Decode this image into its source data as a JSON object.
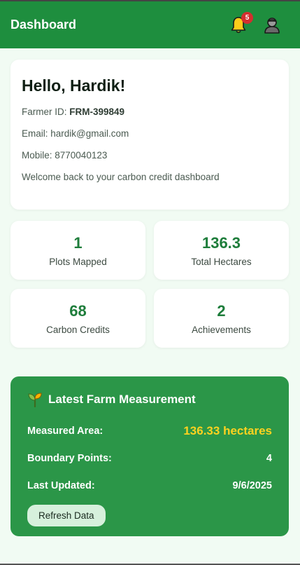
{
  "header": {
    "title": "Dashboard",
    "notification_count": "5",
    "bell_icon": "bell-icon",
    "profile_icon": "user-icon"
  },
  "profile": {
    "greeting": "Hello, Hardik!",
    "farmer_id_label": "Farmer ID: ",
    "farmer_id": "FRM-399849",
    "email": "Email: hardik@gmail.com",
    "mobile": "Mobile: 8770040123",
    "welcome": "Welcome back to your carbon credit dashboard"
  },
  "stats": [
    {
      "value": "1",
      "label": "Plots Mapped"
    },
    {
      "value": "136.3",
      "label": "Total Hectares"
    },
    {
      "value": "68",
      "label": "Carbon Credits"
    },
    {
      "value": "2",
      "label": "Achievements"
    }
  ],
  "measurement": {
    "title": "Latest Farm Measurement",
    "icon": "seedling-icon",
    "area_label": "Measured Area:",
    "area_value": "136.33 hectares",
    "points_label": "Boundary Points:",
    "points_value": "4",
    "updated_label": "Last Updated:",
    "updated_value": "9/6/2025",
    "refresh_label": "Refresh Data"
  },
  "colors": {
    "header_bg": "#1e8e3e",
    "card_green": "#2b9648",
    "stat_text": "#1e7d3b",
    "highlight_yellow": "#ffd21f",
    "badge_red": "#d32f2f"
  }
}
